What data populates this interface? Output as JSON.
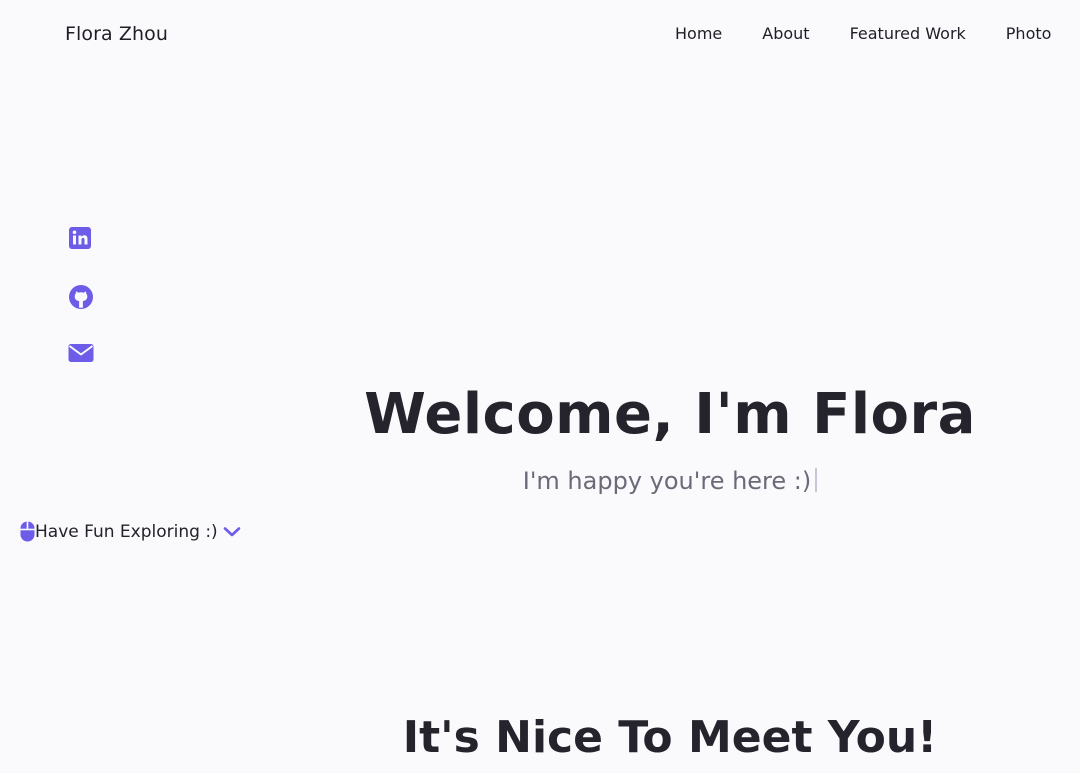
{
  "header": {
    "brand": "Flora Zhou",
    "nav": [
      {
        "label": "Home"
      },
      {
        "label": "About"
      },
      {
        "label": "Featured Work"
      },
      {
        "label": "Photo"
      }
    ]
  },
  "socials": [
    {
      "icon": "linkedin-icon"
    },
    {
      "icon": "github-icon"
    },
    {
      "icon": "envelope-icon"
    }
  ],
  "hero": {
    "title": "Welcome, I'm Flora",
    "subtitle": "I'm happy you're here :)"
  },
  "scroll_hint": {
    "label": "Have Fun Exploring :)",
    "icons": [
      "mouse-icon",
      "chevron-down-icon"
    ]
  },
  "about": {
    "title": "It's Nice To Meet You!"
  },
  "colors": {
    "accent": "#6c5ce7",
    "background": "#fafafd",
    "text": "#23222a",
    "muted": "#6b6a78"
  }
}
